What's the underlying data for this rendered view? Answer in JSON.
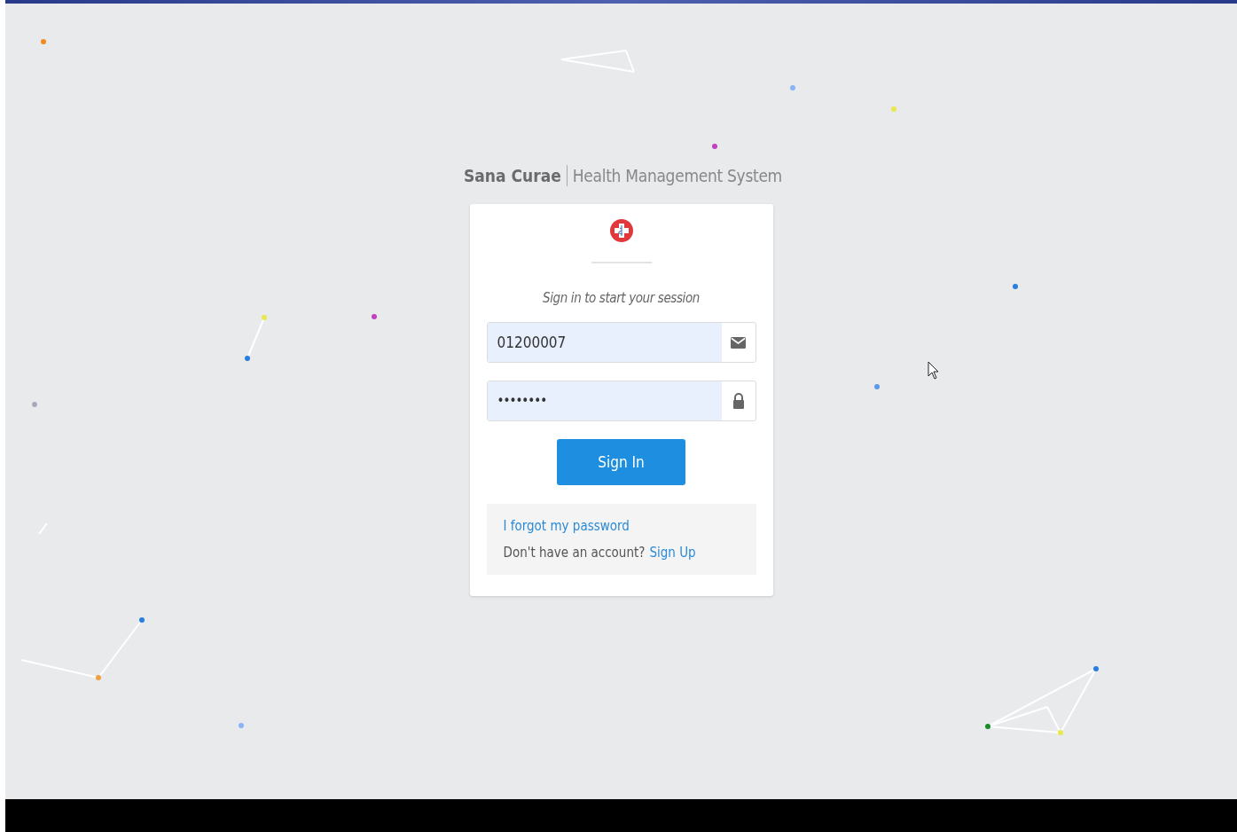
{
  "header": {
    "brand": "Sana Curae",
    "subtitle": "Health Management System"
  },
  "login_box": {
    "message": "Sign in to start your session",
    "fields": [
      {
        "kind": "user",
        "value": "01200007"
      },
      {
        "kind": "password",
        "value": "••••••••"
      }
    ],
    "submit": "Sign In",
    "forgot_link": "I forgot my password",
    "signup_prompt": "Don't have an account?",
    "signup_link": "Sign Up"
  }
}
